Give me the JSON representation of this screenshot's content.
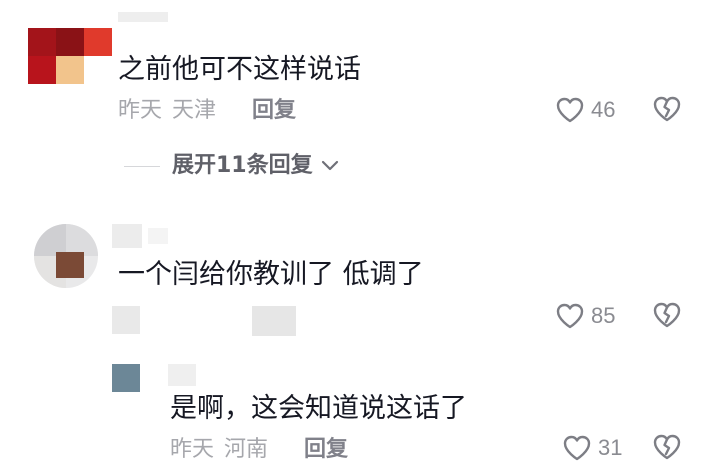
{
  "comments": [
    {
      "text": "之前他可不这样说话",
      "date": "昨天",
      "location": "天津",
      "reply_label": "回复",
      "likes": "46",
      "expand_label": "展开11条回复"
    },
    {
      "text": "一个闫给你教训了 低调了",
      "likes": "85"
    },
    {
      "text": "是啊，这会知道说这话了",
      "date": "昨天",
      "location": "河南",
      "reply_label": "回复",
      "likes": "31"
    }
  ],
  "colors": {
    "text": "#161823",
    "meta": "#a6a7ac",
    "icon": "#7d7e85"
  }
}
